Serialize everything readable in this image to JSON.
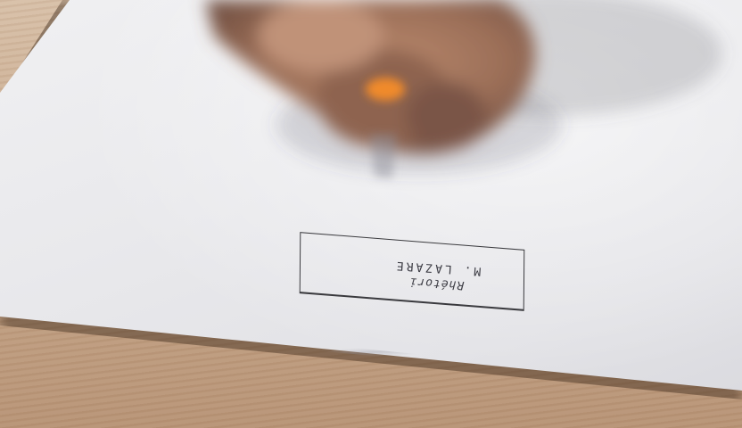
{
  "photo": {
    "subject": "hand writing on paper with pencil",
    "label_box": {
      "line1": "Rhétori",
      "line2": "M. LAZARE"
    }
  },
  "colors": {
    "paper": "#eaeaed",
    "table_wood": "#c8a98c",
    "pencil": "#f08a2c",
    "ink": "#3a3a3e"
  }
}
